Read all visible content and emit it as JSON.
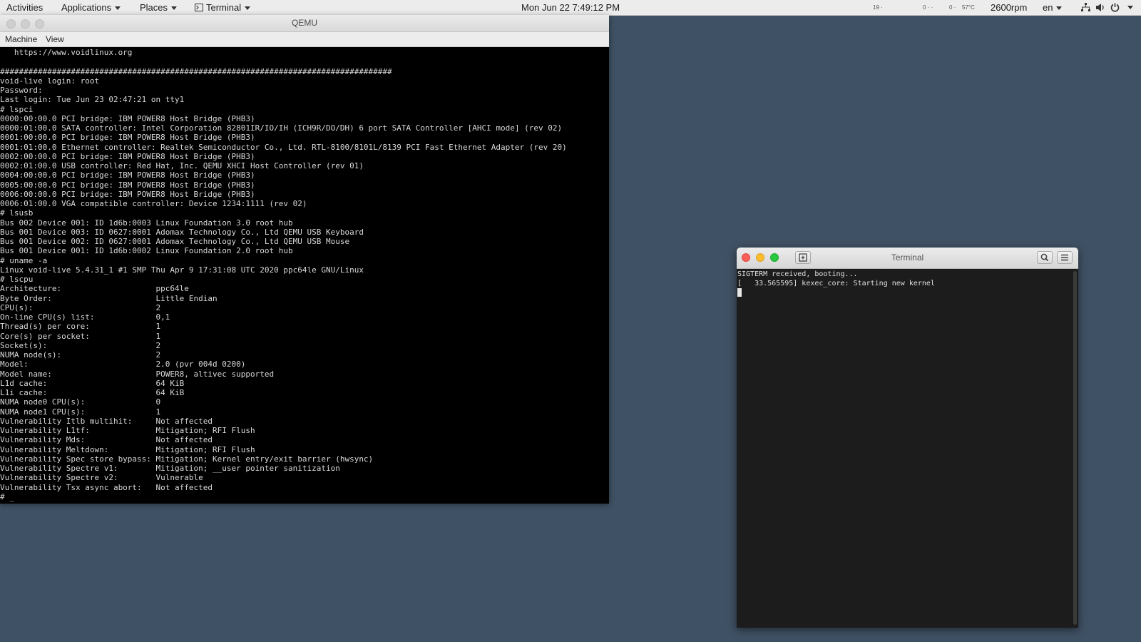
{
  "topbar": {
    "activities": "Activities",
    "applications": "Applications",
    "places": "Places",
    "terminal": "Terminal",
    "clock": "Mon Jun 22   7:49:12 PM",
    "stat1": "19",
    "stat2": "0",
    "stat3": "0",
    "temp": "57°C",
    "fan": "2600rpm",
    "lang": "en"
  },
  "qemu": {
    "title": "QEMU",
    "menu": {
      "machine": "Machine",
      "view": "View"
    },
    "console": [
      "   https://www.voidlinux.org",
      "",
      "###################################################################################",
      "void-live login: root",
      "Password:",
      "Last login: Tue Jun 23 02:47:21 on tty1",
      "# lspci",
      "0000:00:00.0 PCI bridge: IBM POWER8 Host Bridge (PHB3)",
      "0000:01:00.0 SATA controller: Intel Corporation 82801IR/IO/IH (ICH9R/DO/DH) 6 port SATA Controller [AHCI mode] (rev 02)",
      "0001:00:00.0 PCI bridge: IBM POWER8 Host Bridge (PHB3)",
      "0001:01:00.0 Ethernet controller: Realtek Semiconductor Co., Ltd. RTL-8100/8101L/8139 PCI Fast Ethernet Adapter (rev 20)",
      "0002:00:00.0 PCI bridge: IBM POWER8 Host Bridge (PHB3)",
      "0002:01:00.0 USB controller: Red Hat, Inc. QEMU XHCI Host Controller (rev 01)",
      "0004:00:00.0 PCI bridge: IBM POWER8 Host Bridge (PHB3)",
      "0005:00:00.0 PCI bridge: IBM POWER8 Host Bridge (PHB3)",
      "0006:00:00.0 PCI bridge: IBM POWER8 Host Bridge (PHB3)",
      "0006:01:00.0 VGA compatible controller: Device 1234:1111 (rev 02)",
      "# lsusb",
      "Bus 002 Device 001: ID 1d6b:0003 Linux Foundation 3.0 root hub",
      "Bus 001 Device 003: ID 0627:0001 Adomax Technology Co., Ltd QEMU USB Keyboard",
      "Bus 001 Device 002: ID 0627:0001 Adomax Technology Co., Ltd QEMU USB Mouse",
      "Bus 001 Device 001: ID 1d6b:0002 Linux Foundation 2.0 root hub",
      "# uname -a",
      "Linux void-live 5.4.31_1 #1 SMP Thu Apr 9 17:31:08 UTC 2020 ppc64le GNU/Linux",
      "# lscpu",
      "Architecture:                    ppc64le",
      "Byte Order:                      Little Endian",
      "CPU(s):                          2",
      "On-line CPU(s) list:             0,1",
      "Thread(s) per core:              1",
      "Core(s) per socket:              1",
      "Socket(s):                       2",
      "NUMA node(s):                    2",
      "Model:                           2.0 (pvr 004d 0200)",
      "Model name:                      POWER8, altivec supported",
      "L1d cache:                       64 KiB",
      "L1i cache:                       64 KiB",
      "NUMA node0 CPU(s):               0",
      "NUMA node1 CPU(s):               1",
      "Vulnerability Itlb multihit:     Not affected",
      "Vulnerability L1tf:              Mitigation; RFI Flush",
      "Vulnerability Mds:               Not affected",
      "Vulnerability Meltdown:          Mitigation; RFI Flush",
      "Vulnerability Spec store bypass: Mitigation; Kernel entry/exit barrier (hwsync)",
      "Vulnerability Spectre v1:        Mitigation; __user pointer sanitization",
      "Vulnerability Spectre v2:        Vulnerable",
      "Vulnerability Tsx async abort:   Not affected",
      "# _"
    ]
  },
  "terminal": {
    "title": "Terminal",
    "lines": [
      "SIGTERM received, booting...",
      "[   33.565595] kexec_core: Starting new kernel"
    ]
  }
}
